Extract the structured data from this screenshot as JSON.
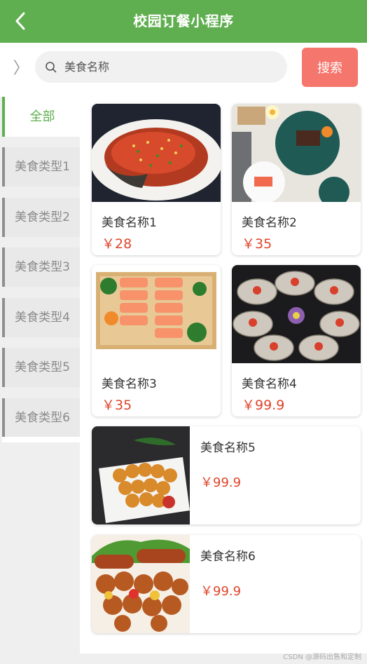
{
  "header": {
    "title": "校园订餐小程序",
    "back_icon": "chevron-left-icon"
  },
  "search": {
    "placeholder": "美食名称",
    "button_label": "搜索"
  },
  "sidebar": {
    "all_label": "全部",
    "categories": [
      {
        "label": "美食类型1"
      },
      {
        "label": "美食类型2"
      },
      {
        "label": "美食类型3"
      },
      {
        "label": "美食类型4"
      },
      {
        "label": "美食类型5"
      },
      {
        "label": "美食类型6"
      }
    ]
  },
  "foods": [
    {
      "name": "美食名称1",
      "price": "￥28"
    },
    {
      "name": "美食名称2",
      "price": "￥35"
    },
    {
      "name": "美食名称3",
      "price": "￥35"
    },
    {
      "name": "美食名称4",
      "price": "￥99.9"
    },
    {
      "name": "美食名称5",
      "price": "￥99.9"
    },
    {
      "name": "美食名称6",
      "price": "￥99.9"
    }
  ],
  "watermark": "CSDN @源码出售和定制",
  "colors": {
    "brand": "#5fae4f",
    "search_button": "#f5766c",
    "price": "#e0442b"
  }
}
